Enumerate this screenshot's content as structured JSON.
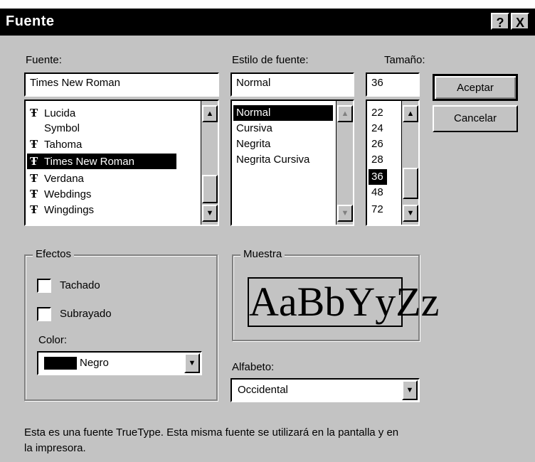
{
  "window": {
    "title": "Fuente",
    "help_glyph": "?",
    "close_glyph": "X"
  },
  "font": {
    "label": "Fuente:",
    "value": "Times New Roman",
    "items": [
      {
        "icon": "truetype",
        "name": "Lucida"
      },
      {
        "icon": "none",
        "name": "Symbol"
      },
      {
        "icon": "truetype",
        "name": "Tahoma"
      },
      {
        "icon": "truetype",
        "name": "Times New Roman"
      },
      {
        "icon": "truetype",
        "name": "Verdana"
      },
      {
        "icon": "truetype",
        "name": "Webdings"
      },
      {
        "icon": "truetype",
        "name": "Wingdings"
      }
    ]
  },
  "style": {
    "label": "Estilo de fuente:",
    "value": "Normal",
    "items": [
      "Normal",
      "Cursiva",
      "Negrita",
      "Negrita Cursiva"
    ]
  },
  "size": {
    "label": "Tamaño:",
    "value": "36",
    "items": [
      "22",
      "24",
      "26",
      "28",
      "36",
      "48",
      "72"
    ]
  },
  "buttons": {
    "accept": "Aceptar",
    "cancel": "Cancelar"
  },
  "effects": {
    "label": "Efectos",
    "strikeout": "Tachado",
    "underline": "Subrayado",
    "color_label": "Color:",
    "color_value": "Negro",
    "color_swatch": "#000000"
  },
  "sample": {
    "label": "Muestra",
    "text": "AaBbYyZz"
  },
  "script": {
    "label": "Alfabeto:",
    "value": "Occidental"
  },
  "footer": {
    "text": "Esta es una fuente TrueType. Esta misma fuente se utilizará en la pantalla y en la impresora."
  },
  "icons": {
    "scroll_up": "▲",
    "scroll_down": "▼",
    "truetype": "Ŧ"
  }
}
